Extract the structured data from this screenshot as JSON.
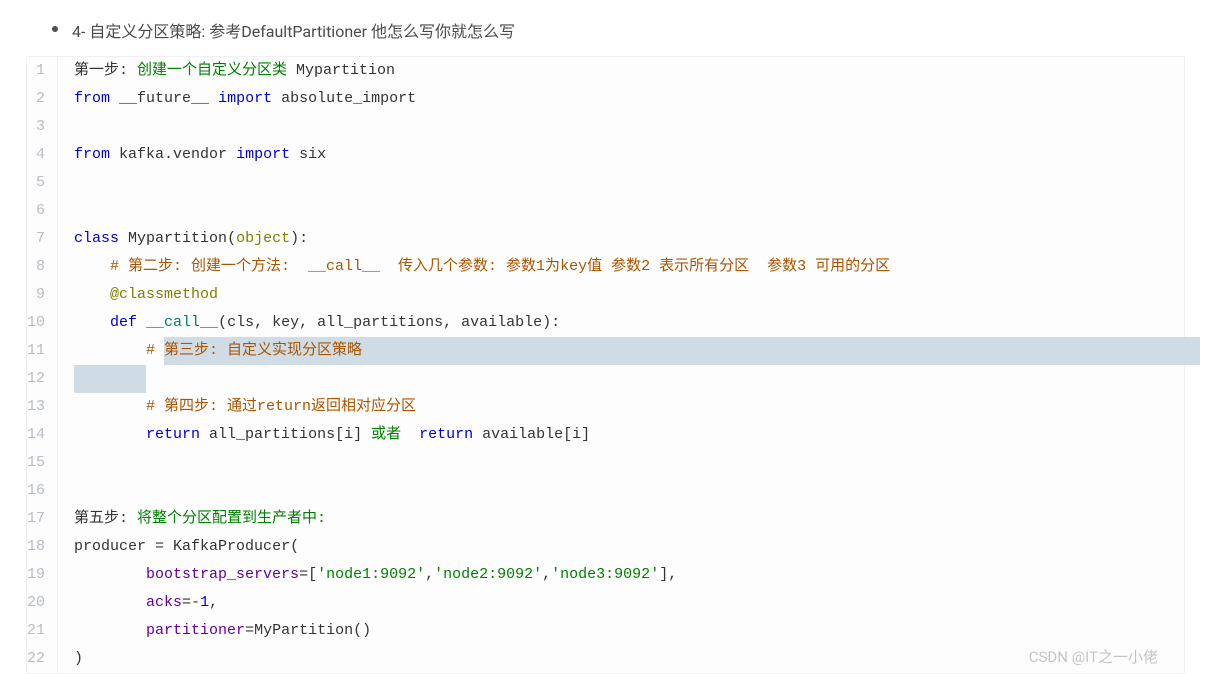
{
  "bullet": {
    "text": "4- 自定义分区策略:  参考DefaultPartitioner  他怎么写你就怎么写"
  },
  "code": {
    "lines": [
      {
        "num": 1,
        "highlight": false,
        "tokens": [
          {
            "t": "第一步: ",
            "c": "c-plain"
          },
          {
            "t": "创建一个自定义分区类 ",
            "c": "c-green"
          },
          {
            "t": "Mypartition",
            "c": "c-plain"
          }
        ]
      },
      {
        "num": 2,
        "highlight": false,
        "tokens": [
          {
            "t": "from ",
            "c": "c-kwblue"
          },
          {
            "t": "__future__ ",
            "c": "c-plain"
          },
          {
            "t": "import ",
            "c": "c-kwblue"
          },
          {
            "t": "absolute_import",
            "c": "c-plain"
          }
        ]
      },
      {
        "num": 3,
        "highlight": false,
        "tokens": [
          {
            "t": "",
            "c": "c-plain"
          }
        ]
      },
      {
        "num": 4,
        "highlight": false,
        "tokens": [
          {
            "t": "from ",
            "c": "c-kwblue"
          },
          {
            "t": "kafka.vendor ",
            "c": "c-plain"
          },
          {
            "t": "import ",
            "c": "c-kwblue"
          },
          {
            "t": "six",
            "c": "c-plain"
          }
        ]
      },
      {
        "num": 5,
        "highlight": false,
        "tokens": [
          {
            "t": "",
            "c": "c-plain"
          }
        ]
      },
      {
        "num": 6,
        "highlight": false,
        "tokens": [
          {
            "t": "",
            "c": "c-plain"
          }
        ]
      },
      {
        "num": 7,
        "highlight": false,
        "tokens": [
          {
            "t": "class ",
            "c": "c-kwblue"
          },
          {
            "t": "Mypartition",
            "c": "c-plain"
          },
          {
            "t": "(",
            "c": "c-plain"
          },
          {
            "t": "object",
            "c": "c-olive"
          },
          {
            "t": "):",
            "c": "c-plain"
          }
        ]
      },
      {
        "num": 8,
        "highlight": false,
        "tokens": [
          {
            "t": "    ",
            "c": "c-plain"
          },
          {
            "t": "# 第二步: 创建一个方法:  __call__  传入几个参数: 参数1为key值 参数2 表示所有分区  参数3 可用的分区",
            "c": "c-orange"
          }
        ]
      },
      {
        "num": 9,
        "highlight": false,
        "tokens": [
          {
            "t": "    ",
            "c": "c-plain"
          },
          {
            "t": "@classmethod",
            "c": "c-olive"
          }
        ]
      },
      {
        "num": 10,
        "highlight": false,
        "tokens": [
          {
            "t": "    ",
            "c": "c-plain"
          },
          {
            "t": "def ",
            "c": "c-kwblue"
          },
          {
            "t": "__call__",
            "c": "c-teal"
          },
          {
            "t": "(",
            "c": "c-plain"
          },
          {
            "t": "cls, key, all_partitions, available",
            "c": "c-plain"
          },
          {
            "t": "):",
            "c": "c-plain"
          }
        ]
      },
      {
        "num": 11,
        "highlight": true,
        "tokens": [
          {
            "t": "        ",
            "c": "c-plain"
          },
          {
            "t": "# ",
            "c": "c-orange"
          },
          {
            "t": "第三步: 自定义实现分区策略",
            "c": "c-orange",
            "hl": true
          }
        ]
      },
      {
        "num": 12,
        "highlight": true,
        "tokens": [
          {
            "t": "        ",
            "c": "c-plain",
            "hl": true
          }
        ]
      },
      {
        "num": 13,
        "highlight": false,
        "tokens": [
          {
            "t": "        ",
            "c": "c-plain"
          },
          {
            "t": "# 第四步: 通过return返回相对应分区",
            "c": "c-orange"
          }
        ]
      },
      {
        "num": 14,
        "highlight": false,
        "tokens": [
          {
            "t": "        ",
            "c": "c-plain"
          },
          {
            "t": "return ",
            "c": "c-kwblue"
          },
          {
            "t": "all_partitions[i] ",
            "c": "c-plain"
          },
          {
            "t": "或者  ",
            "c": "c-green"
          },
          {
            "t": "return ",
            "c": "c-kwblue"
          },
          {
            "t": "available[i]",
            "c": "c-plain"
          }
        ]
      },
      {
        "num": 15,
        "highlight": false,
        "tokens": [
          {
            "t": "",
            "c": "c-plain"
          }
        ]
      },
      {
        "num": 16,
        "highlight": false,
        "tokens": [
          {
            "t": "",
            "c": "c-plain"
          }
        ]
      },
      {
        "num": 17,
        "highlight": false,
        "tokens": [
          {
            "t": "第五步: ",
            "c": "c-plain"
          },
          {
            "t": "将整个分区配置到生产者中:",
            "c": "c-green"
          }
        ]
      },
      {
        "num": 18,
        "highlight": false,
        "tokens": [
          {
            "t": "producer ",
            "c": "c-plain"
          },
          {
            "t": "= ",
            "c": "c-plain"
          },
          {
            "t": "KafkaProducer",
            "c": "c-plain"
          },
          {
            "t": "(",
            "c": "c-plain"
          }
        ]
      },
      {
        "num": 19,
        "highlight": false,
        "tokens": [
          {
            "t": "        ",
            "c": "c-plain"
          },
          {
            "t": "bootstrap_servers",
            "c": "c-purple"
          },
          {
            "t": "=[",
            "c": "c-plain"
          },
          {
            "t": "'node1:9092'",
            "c": "c-str"
          },
          {
            "t": ",",
            "c": "c-plain"
          },
          {
            "t": "'node2:9092'",
            "c": "c-str"
          },
          {
            "t": ",",
            "c": "c-plain"
          },
          {
            "t": "'node3:9092'",
            "c": "c-str"
          },
          {
            "t": "],",
            "c": "c-plain"
          }
        ]
      },
      {
        "num": 20,
        "highlight": false,
        "tokens": [
          {
            "t": "        ",
            "c": "c-plain"
          },
          {
            "t": "acks",
            "c": "c-purple"
          },
          {
            "t": "=-",
            "c": "c-plain"
          },
          {
            "t": "1",
            "c": "c-num"
          },
          {
            "t": ",",
            "c": "c-plain"
          }
        ]
      },
      {
        "num": 21,
        "highlight": false,
        "tokens": [
          {
            "t": "        ",
            "c": "c-plain"
          },
          {
            "t": "partitioner",
            "c": "c-purple"
          },
          {
            "t": "=",
            "c": "c-plain"
          },
          {
            "t": "MyPartition()",
            "c": "c-plain"
          }
        ]
      },
      {
        "num": 22,
        "highlight": false,
        "tokens": [
          {
            "t": ")",
            "c": "c-plain"
          }
        ]
      }
    ]
  },
  "watermark": "CSDN @IT之一小佬"
}
